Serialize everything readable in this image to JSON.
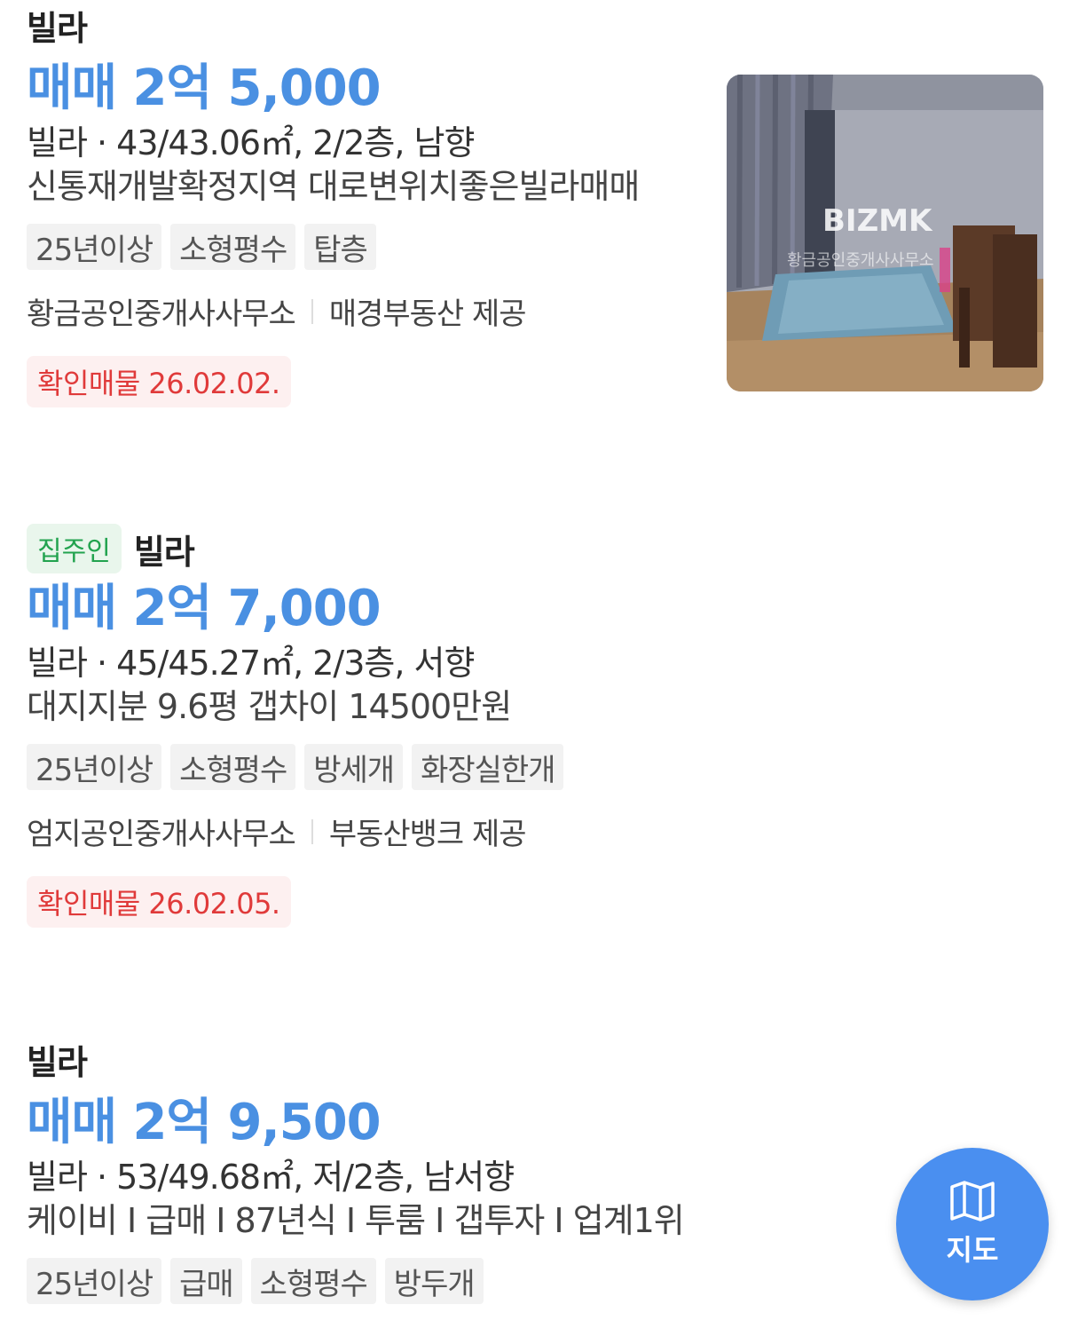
{
  "listings": [
    {
      "owner_badge": "",
      "title": "빌라",
      "price": "매매 2억 5,000",
      "spec": "빌라 · 43/43.06㎡, 2/2층, 남향",
      "description": "신통재개발확정지역 대로변위치좋은빌라매매",
      "tags": [
        "25년이상",
        "소형평수",
        "탑층"
      ],
      "agency": "황금공인중개사사무소",
      "provider": "매경부동산 제공",
      "confirmed": "확인매물 26.02.02.",
      "thumbnail": {
        "watermark": "BIZMK",
        "watermark_sub": "황금공인중개사사무소"
      }
    },
    {
      "owner_badge": "집주인",
      "title": "빌라",
      "price": "매매 2억 7,000",
      "spec": "빌라 · 45/45.27㎡, 2/3층, 서향",
      "description": "대지지분 9.6평 갭차이 14500만원",
      "tags": [
        "25년이상",
        "소형평수",
        "방세개",
        "화장실한개"
      ],
      "agency": "엄지공인중개사사무소",
      "provider": "부동산뱅크 제공",
      "confirmed": "확인매물 26.02.05."
    },
    {
      "owner_badge": "",
      "title": "빌라",
      "price": "매매 2억 9,500",
      "spec": "빌라 · 53/49.68㎡, 저/2층, 남서향",
      "description": "케이비 I 급매 I 87년식 I 투룸 I 갭투자 I 업계1위",
      "tags": [
        "25년이상",
        "급매",
        "소형평수",
        "방두개"
      ]
    }
  ],
  "map_button": {
    "label": "지도",
    "icon": "map-icon"
  },
  "colors": {
    "price": "#4a90e2",
    "owner_badge_text": "#22a34f",
    "owner_badge_bg": "#e9f6ec",
    "confirm_text": "#e03a3a",
    "confirm_bg": "#fdf0f0",
    "tag_bg": "#f2f2f2",
    "map_button_bg": "#4a8ff0"
  }
}
